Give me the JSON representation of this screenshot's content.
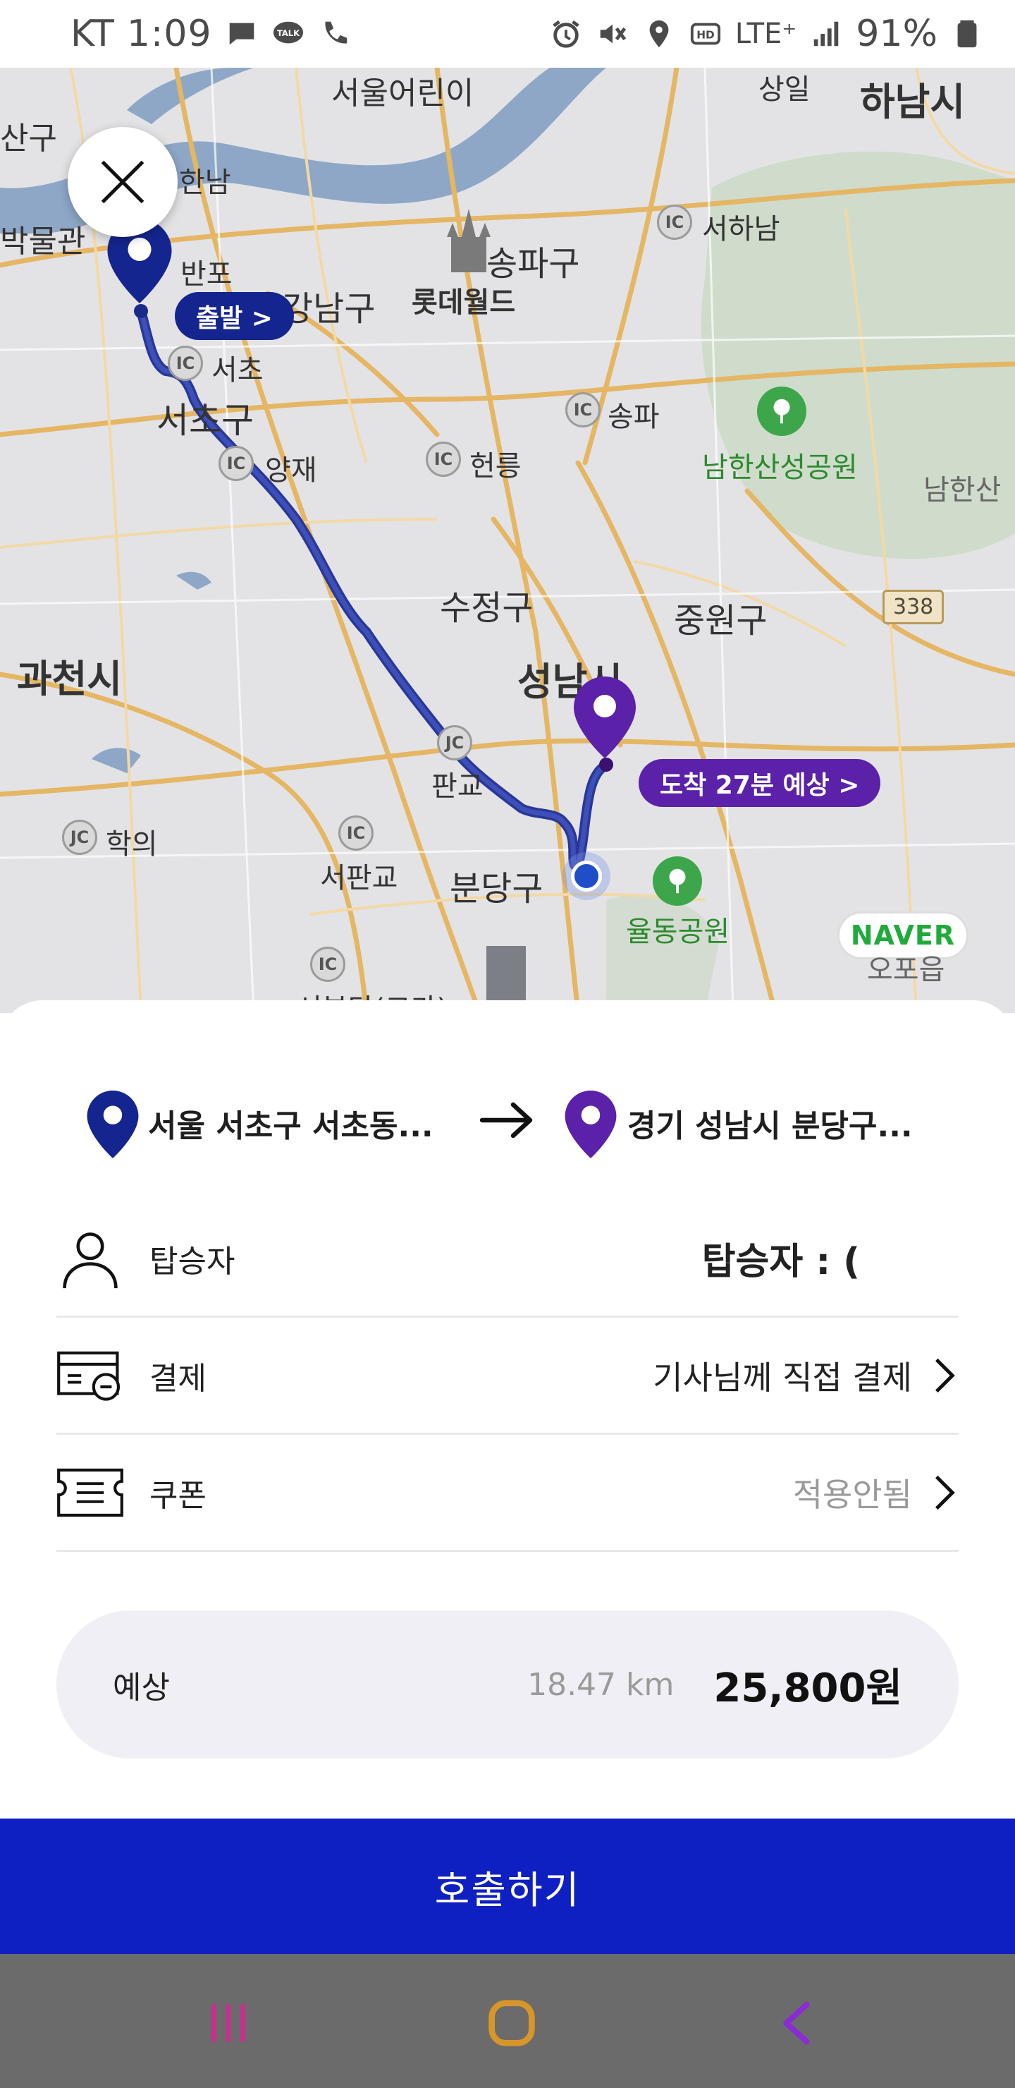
{
  "status_bar": {
    "carrier": "KT",
    "time": "1:09",
    "network": "LTE⁺",
    "battery": "91%"
  },
  "map": {
    "labels": {
      "seoul_children": "서울어린이",
      "sangil": "상일",
      "hanam": "하남시",
      "sangu": "산구",
      "hannam": "한남",
      "museum": "박물관",
      "banpo": "반포",
      "songpa_gu": "송파구",
      "lotte_world": "롯데월드",
      "seohanam": "서하남",
      "gangnam": "강남구",
      "seocho_ic": "서초",
      "seocho_gu": "서초구",
      "songpa": "송파",
      "namhansan_park": "남한산성공원",
      "namhansan": "남한산",
      "yangjae": "양재",
      "heolleung": "헌릉",
      "sujeong": "수정구",
      "jungwon": "중원구",
      "route_338": "338",
      "gwacheon": "과천시",
      "seongnam": "성남시",
      "pangyo": "판교",
      "hagui": "학의",
      "seopangyo": "서판교",
      "bundang": "분당구",
      "yuldong_park": "율동공원",
      "ojeop": "오포읍",
      "seobundang": "서분당(고가)",
      "naver": "NAVER"
    },
    "ic": "IC",
    "jc": "JC",
    "start_chip": "출발 >",
    "arrive_chip": "도착 27분 예상 >"
  },
  "route": {
    "origin": "서울 서초구 서초동...",
    "destination": "경기 성남시 분당구..."
  },
  "rows": {
    "passenger": {
      "label": "탑승자",
      "value": "탑승자 : ("
    },
    "payment": {
      "label": "결제",
      "value": "기사님께 직접 결제"
    },
    "coupon": {
      "label": "쿠폰",
      "value": "적용안됨"
    }
  },
  "fare": {
    "label": "예상",
    "distance": "18.47 km",
    "price": "25,800원"
  },
  "call_button": "호출하기",
  "colors": {
    "primary": "#0f20c2",
    "start_pin": "#14258f",
    "dest_pin": "#5b21a8",
    "route_line": "#2a3796"
  }
}
